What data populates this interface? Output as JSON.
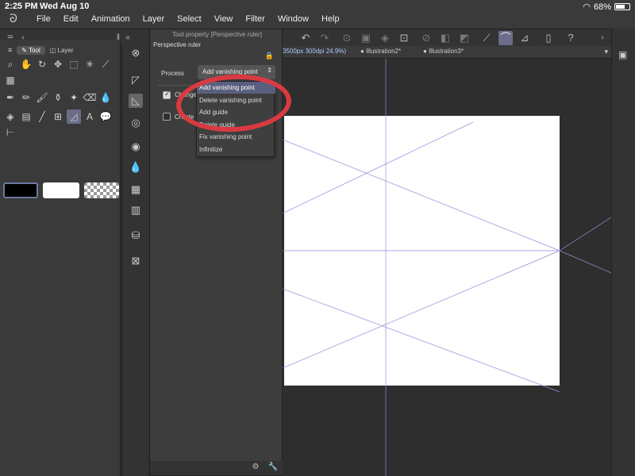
{
  "status": {
    "time": "2:25 PM",
    "date": "Wed Aug 10",
    "battery": "68%",
    "battery_level": 0.68
  },
  "menu": [
    "File",
    "Edit",
    "Animation",
    "Layer",
    "Select",
    "View",
    "Filter",
    "Window",
    "Help"
  ],
  "tool_panel": {
    "tabs": [
      "Tool",
      "Layer"
    ],
    "tools_row1": [
      "magnifier-icon",
      "hand-icon",
      "rotate-icon",
      "move-icon",
      "select-rect-icon",
      "magic-wand-icon",
      "eyedropper-icon"
    ],
    "tools_row2": [
      "pen-icon",
      "pencil-icon",
      "brush-icon",
      "airbrush-icon",
      "decoration-icon",
      "eraser-icon",
      "blend-icon"
    ],
    "tools_row3": [
      "fill-icon",
      "gradient-icon",
      "line-icon",
      "frame-icon",
      "ruler-icon",
      "text-icon",
      "balloon-icon"
    ]
  },
  "property": {
    "title": "Tool property [Perspective ruler]",
    "subtitle": "Perspective ruler",
    "process_label": "Process",
    "process_value": "Add vanishing point",
    "checkbox1_label": "Change",
    "checkbox1_checked": true,
    "checkbox2_label": "Create",
    "checkbox2_checked": false
  },
  "dropdown": {
    "items": [
      "Add vanishing point",
      "Delete vanishing point",
      "Add guide",
      "Delete guide",
      "Fix vanishing point",
      "Infinitize"
    ],
    "selected_index": 0
  },
  "document_tabs": [
    {
      "label": "3500px 300dpi 24.9%)",
      "active": true
    },
    {
      "label": "Illustration2*",
      "active": false
    },
    {
      "label": "Illustration3*",
      "active": false
    }
  ],
  "colors": {
    "annotation": "#d93a41",
    "highlight": "#5b5f7e",
    "guide": "#8f8fd6"
  }
}
